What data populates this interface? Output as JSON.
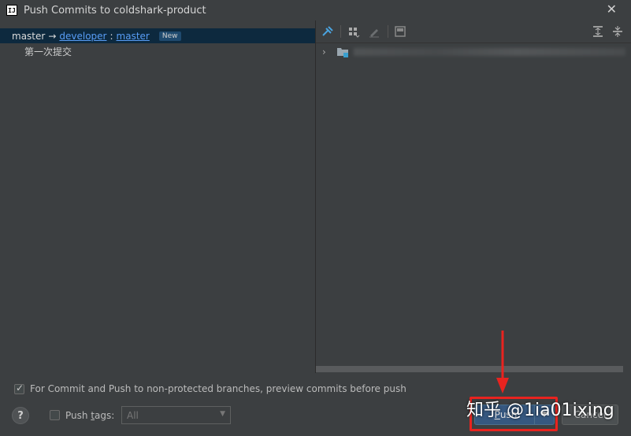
{
  "window": {
    "app_icon_text": "IJ",
    "title": "Push Commits to coldshark-product",
    "close_icon": "close-icon"
  },
  "left_pane": {
    "branch_row": {
      "source": "master",
      "arrow": "→",
      "remote": "developer",
      "separator": ":",
      "target": "master",
      "badge": "New"
    },
    "commits": [
      {
        "message": "第一次提交"
      }
    ]
  },
  "right_pane": {
    "toolbar_icons": [
      "pin-icon",
      "group-by-icon",
      "edit-icon",
      "diff-icon",
      "expand-all-icon",
      "collapse-all-icon"
    ],
    "tree_row_icon": "folder-icon"
  },
  "bottom": {
    "preview_checkbox": {
      "checked": true,
      "label": "For Commit and Push to non-protected branches, preview commits before push"
    },
    "help_label": "?",
    "push_tags": {
      "checked": false,
      "label_prefix": "Push ",
      "label_mnemonic": "t",
      "label_suffix": "ags:"
    },
    "tags_select": {
      "value": "All"
    },
    "push_button": {
      "mnemonic": "P",
      "rest": "ush"
    },
    "cancel_button": "Cancel"
  },
  "overlay": {
    "watermark": "知乎 @1ia01ixing",
    "highlight_color": "#e8231f"
  },
  "colors": {
    "background": "#3c3f41",
    "selection": "#0d293e",
    "link": "#589df6",
    "primary_button": "#365880"
  }
}
